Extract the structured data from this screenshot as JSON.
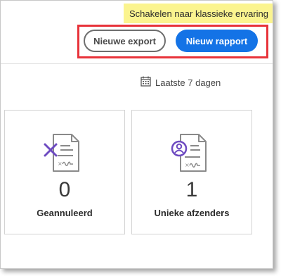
{
  "banner": {
    "switch_label": "Schakelen naar klassieke ervaring"
  },
  "toolbar": {
    "new_export_label": "Nieuwe export",
    "new_report_label": "Nieuw rapport"
  },
  "filter": {
    "date_range": "Laatste 7 dagen",
    "icon": "calendar-icon"
  },
  "cards": [
    {
      "value": "0",
      "label": "Geannuleerd",
      "icon": "cancelled-document-icon"
    },
    {
      "value": "1",
      "label": "Unieke afzenders",
      "icon": "sender-document-icon"
    }
  ],
  "colors": {
    "accent": "#1473e6",
    "banner_bg": "#fbf48f",
    "highlight": "#e8333a",
    "icon_purple": "#6e4bc1"
  }
}
